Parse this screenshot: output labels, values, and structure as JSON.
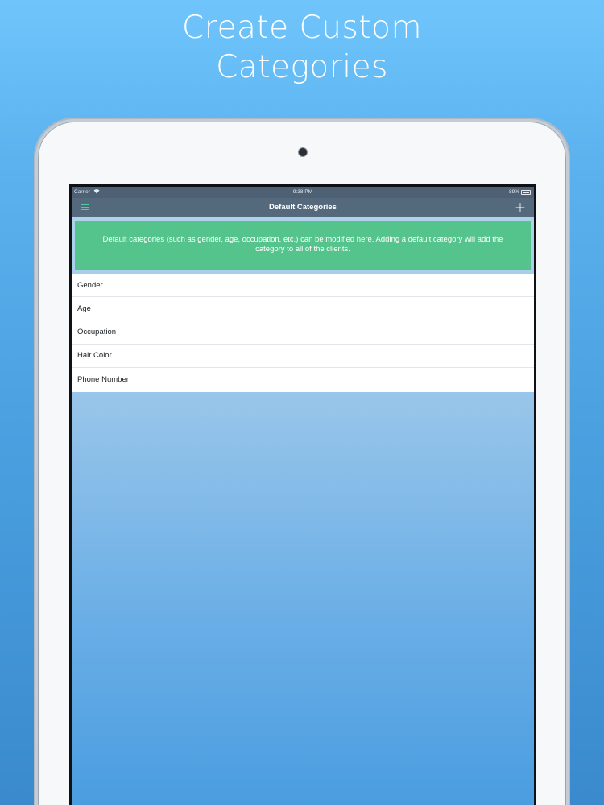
{
  "promo": {
    "line1": "Create Custom",
    "line2": "Categories"
  },
  "status_bar": {
    "carrier": "Carrier",
    "wifi_icon": "wifi-icon",
    "time": "9:38 PM",
    "battery": "89%"
  },
  "nav": {
    "menu_icon": "hamburger-menu-icon",
    "title": "Default Categories",
    "add_icon": "plus-icon",
    "add_label": "+"
  },
  "banner": {
    "text": "Default categories (such as gender, age, occupation, etc.)  can be modified here. Adding a default category will add the category to all of the clients."
  },
  "categories": [
    {
      "label": "Gender"
    },
    {
      "label": "Age"
    },
    {
      "label": "Occupation"
    },
    {
      "label": "Hair Color"
    },
    {
      "label": "Phone Number"
    }
  ],
  "colors": {
    "nav_bar": "#55697d",
    "banner": "#54c48c",
    "accent": "#47d09a"
  }
}
